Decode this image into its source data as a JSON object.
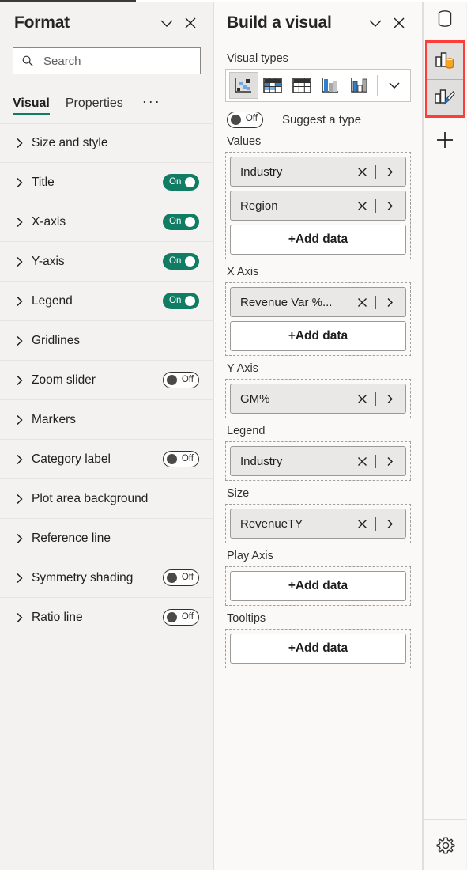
{
  "format_pane": {
    "title": "Format",
    "collapse_icon": "chevron-down-icon",
    "close_icon": "close-icon",
    "search": {
      "placeholder": "Search",
      "value": "",
      "icon": "search-icon"
    },
    "tabs": [
      {
        "label": "Visual",
        "active": true
      },
      {
        "label": "Properties",
        "active": false
      }
    ],
    "more_label": "···",
    "accent_color": "#107c63",
    "rows": [
      {
        "label": "Size and style",
        "toggle": null
      },
      {
        "label": "Title",
        "toggle": "On"
      },
      {
        "label": "X-axis",
        "toggle": "On"
      },
      {
        "label": "Y-axis",
        "toggle": "On"
      },
      {
        "label": "Legend",
        "toggle": "On"
      },
      {
        "label": "Gridlines",
        "toggle": null
      },
      {
        "label": "Zoom slider",
        "toggle": "Off"
      },
      {
        "label": "Markers",
        "toggle": null
      },
      {
        "label": "Category label",
        "toggle": "Off"
      },
      {
        "label": "Plot area background",
        "toggle": null
      },
      {
        "label": "Reference line",
        "toggle": null
      },
      {
        "label": "Symmetry shading",
        "toggle": "Off"
      },
      {
        "label": "Ratio line",
        "toggle": "Off"
      }
    ]
  },
  "build_pane": {
    "title": "Build a visual",
    "collapse_icon": "chevron-down-icon",
    "close_icon": "close-icon",
    "visual_types": {
      "label": "Visual types",
      "items": [
        {
          "name": "scatter-chart",
          "selected": true
        },
        {
          "name": "matrix-visual",
          "selected": false
        },
        {
          "name": "table-visual",
          "selected": false
        },
        {
          "name": "clustered-column-chart",
          "selected": false
        },
        {
          "name": "stacked-column-chart",
          "selected": false
        }
      ],
      "more_icon": "chevron-down-icon"
    },
    "suggest": {
      "toggle": "Off",
      "label": "Suggest a type"
    },
    "wells": [
      {
        "label": "Values",
        "fields": [
          {
            "name": "Industry"
          },
          {
            "name": "Region"
          }
        ],
        "add_label": "+Add data"
      },
      {
        "label": "X Axis",
        "fields": [
          {
            "name": "Revenue Var %..."
          }
        ],
        "add_label": "+Add data"
      },
      {
        "label": "Y Axis",
        "fields": [
          {
            "name": "GM%"
          }
        ],
        "add_label": null
      },
      {
        "label": "Legend",
        "fields": [
          {
            "name": "Industry"
          }
        ],
        "add_label": null
      },
      {
        "label": "Size",
        "fields": [
          {
            "name": "RevenueTY"
          }
        ],
        "add_label": null
      },
      {
        "label": "Play Axis",
        "fields": [],
        "add_label": "+Add data"
      },
      {
        "label": "Tooltips",
        "fields": [],
        "add_label": "+Add data"
      }
    ]
  },
  "icon_rail": {
    "data_icon": "database-cylinder-icon",
    "highlight_color": "#fc3d39",
    "highlighted_buttons": [
      {
        "name": "build-visual-icon"
      },
      {
        "name": "format-visual-icon"
      }
    ],
    "add_icon": "plus-icon",
    "settings_icon": "gear-icon"
  }
}
